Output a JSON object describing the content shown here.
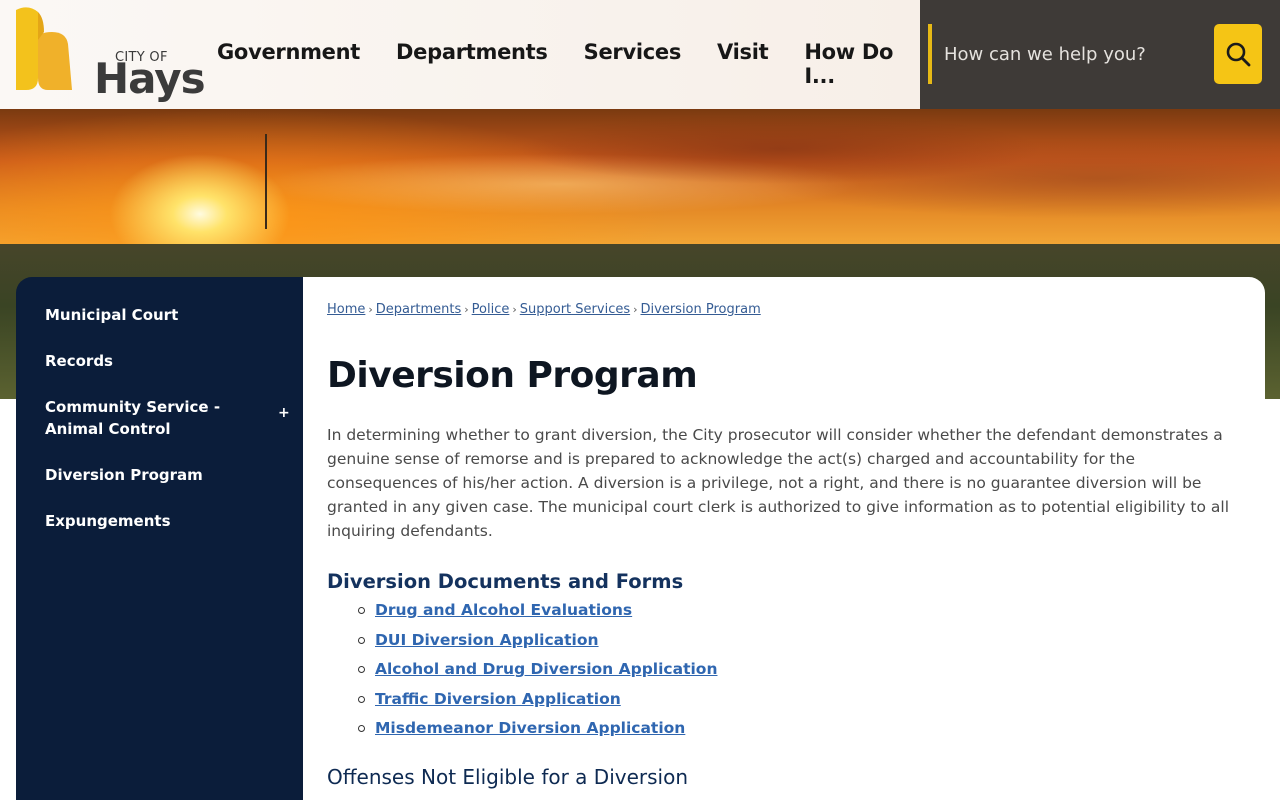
{
  "header": {
    "logo_city": "CITY OF",
    "logo_name": "Hays",
    "nav": [
      "Government",
      "Departments",
      "Services",
      "Visit",
      "How Do I..."
    ],
    "search_placeholder": "How can we help you?",
    "colors": {
      "accent": "#f5c515",
      "header_dark": "#3e3a37"
    }
  },
  "sidebar": {
    "items": [
      {
        "label": "Municipal Court"
      },
      {
        "label": "Records"
      },
      {
        "label": "Community Service - Animal Control",
        "expand": "+"
      },
      {
        "label": "Diversion Program"
      },
      {
        "label": "Expungements"
      }
    ],
    "colors": {
      "background": "#0b1d3a"
    }
  },
  "breadcrumb": [
    "Home",
    "Departments",
    "Police",
    "Support Services",
    "Diversion Program"
  ],
  "page": {
    "title": "Diversion Program",
    "intro": "In determining whether to grant diversion, the City prosecutor will consider whether the defendant demonstrates a genuine sense of remorse and is prepared to acknowledge the act(s) charged and accountability for the consequences of his/her action. A diversion is a privilege, not a right, and there is no guarantee diversion will be granted in any given case. The municipal court clerk is authorized to give information as to potential eligibility to all inquiring defendants.",
    "documents_heading": "Diversion Documents and Forms",
    "documents": [
      "Drug and Alcohol Evaluations",
      "DUI Diversion Application ",
      "Alcohol and Drug Diversion Application",
      "Traffic Diversion Application",
      "Misdemeanor Diversion Application"
    ],
    "offenses_heading": "Offenses Not Eligible for a Diversion"
  }
}
